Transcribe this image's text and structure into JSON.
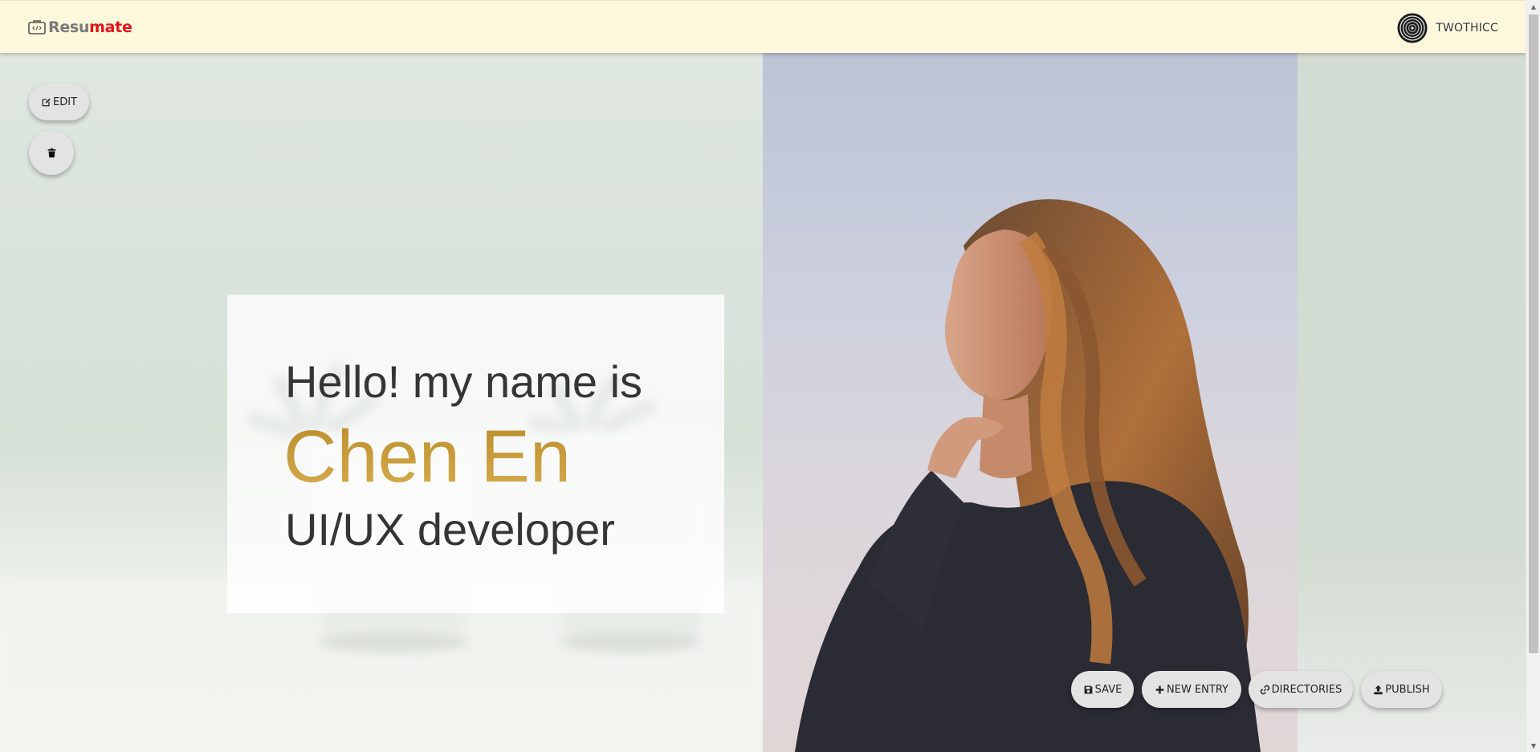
{
  "navbar": {
    "brand_part1": "Resu",
    "brand_part2": "mate",
    "brand_icon": "code-briefcase-icon",
    "username": "TWOTHICC",
    "avatar_icon": "spiral-avatar-icon"
  },
  "hero": {
    "greeting": "Hello! my name is",
    "name": "Chen En",
    "role": "UI/UX developer"
  },
  "actions": {
    "edit": "EDIT",
    "save": "SAVE",
    "new_entry": "NEW ENTRY",
    "directories": "DIRECTORIES",
    "publish": "PUBLISH"
  },
  "colors": {
    "navbar_bg": "#fdf8dc",
    "brand_grey": "#7a7a7a",
    "brand_red": "#e3141b",
    "name_gold": "#c99b3b",
    "button_bg": "#e3e3e3"
  }
}
